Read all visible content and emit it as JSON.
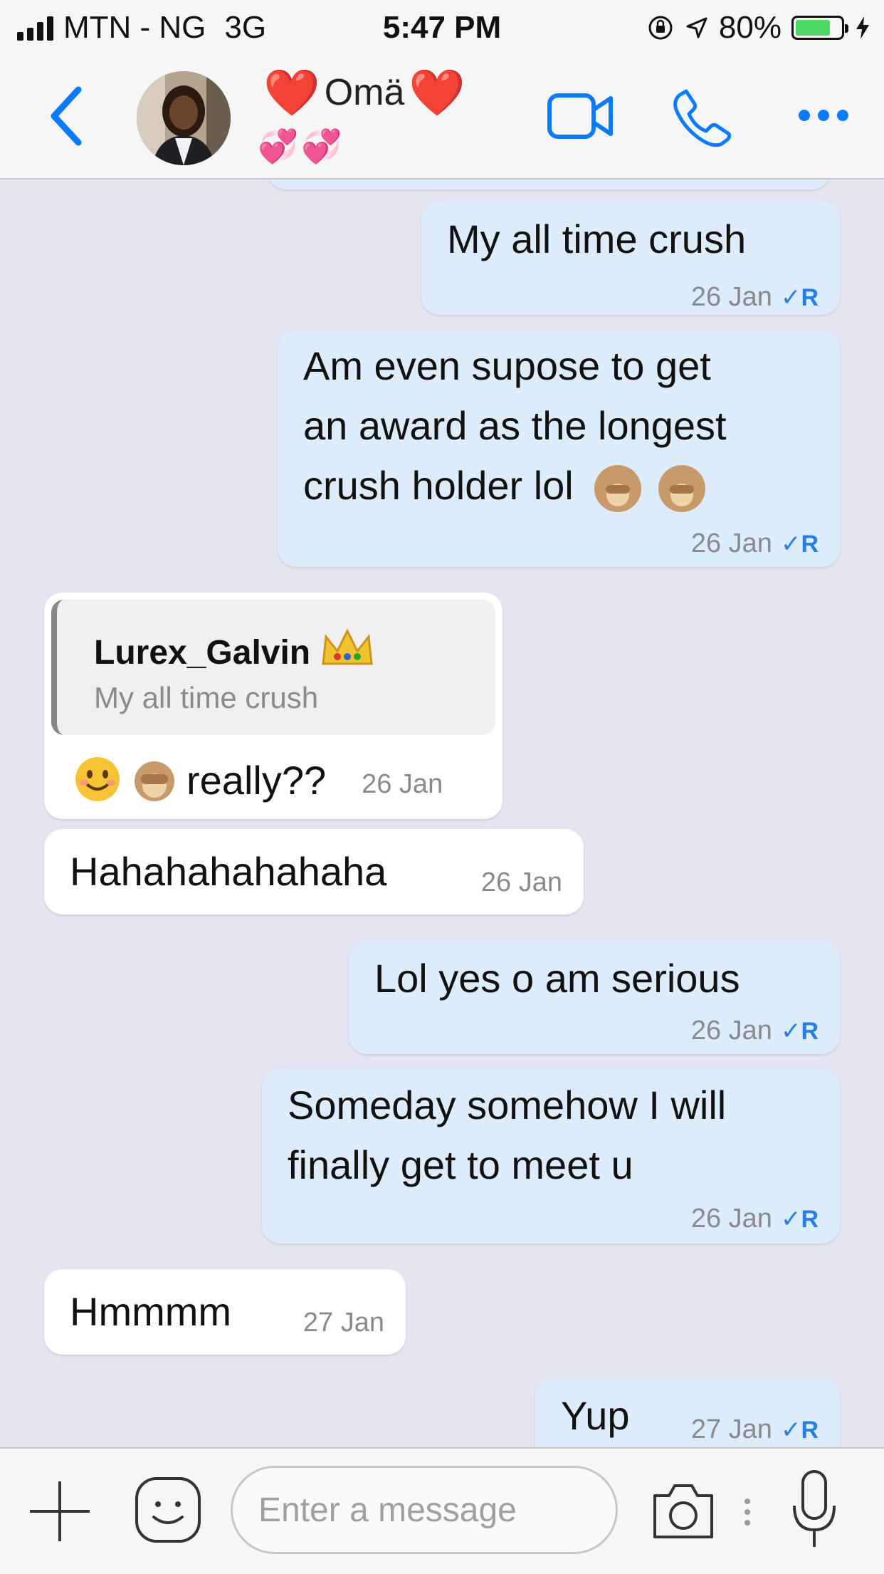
{
  "status_bar": {
    "carrier": "MTN - NG",
    "network": "3G",
    "time": "5:47 PM",
    "battery_percent": "80%",
    "battery_level": 0.8
  },
  "header": {
    "contact_name": "Omä",
    "heart_emoji": "❤️",
    "decoration": "💞💞",
    "icons": [
      "back-chevron-icon",
      "video-call-icon",
      "phone-icon",
      "more-icon"
    ],
    "accent_color": "#0a7bff"
  },
  "messages": [
    {
      "direction": "out",
      "text": "My all time crush",
      "time": "26 Jan",
      "receipt": "R"
    },
    {
      "direction": "out",
      "text": "Am even supose to get an award as the longest crush holder lol 🙈 🙈",
      "lines": [
        "Am even supose to get",
        "an award as the longest",
        "crush holder lol"
      ],
      "time": "26 Jan",
      "receipt": "R"
    },
    {
      "direction": "in",
      "reply_to": {
        "name": "Lurex_Galvin",
        "name_emoji": "👑",
        "text": "My all time crush"
      },
      "text": "really??",
      "prefix_emojis": [
        "😊",
        "🙈"
      ],
      "time": "26 Jan"
    },
    {
      "direction": "in",
      "text": "Hahahahahahaha",
      "time": "26 Jan"
    },
    {
      "direction": "out",
      "text": "Lol yes o am serious",
      "time": "26 Jan",
      "receipt": "R"
    },
    {
      "direction": "out",
      "text": "Someday somehow I will finally get to meet u",
      "lines": [
        "Someday somehow I will",
        "finally get to meet u"
      ],
      "time": "26 Jan",
      "receipt": "R"
    },
    {
      "direction": "in",
      "text": "Hmmmm",
      "time": "27 Jan"
    },
    {
      "direction": "out",
      "text": "Yup",
      "time": "27 Jan",
      "receipt": "R"
    }
  ],
  "composer": {
    "placeholder": "Enter a message",
    "icons": [
      "plus-icon",
      "sticker-icon",
      "camera-icon",
      "microphone-icon"
    ]
  },
  "colors": {
    "background": "#e4e5f1",
    "outgoing_bubble": "#dcecfb",
    "incoming_bubble": "#ffffff",
    "read_receipt": "#2a7de1"
  }
}
